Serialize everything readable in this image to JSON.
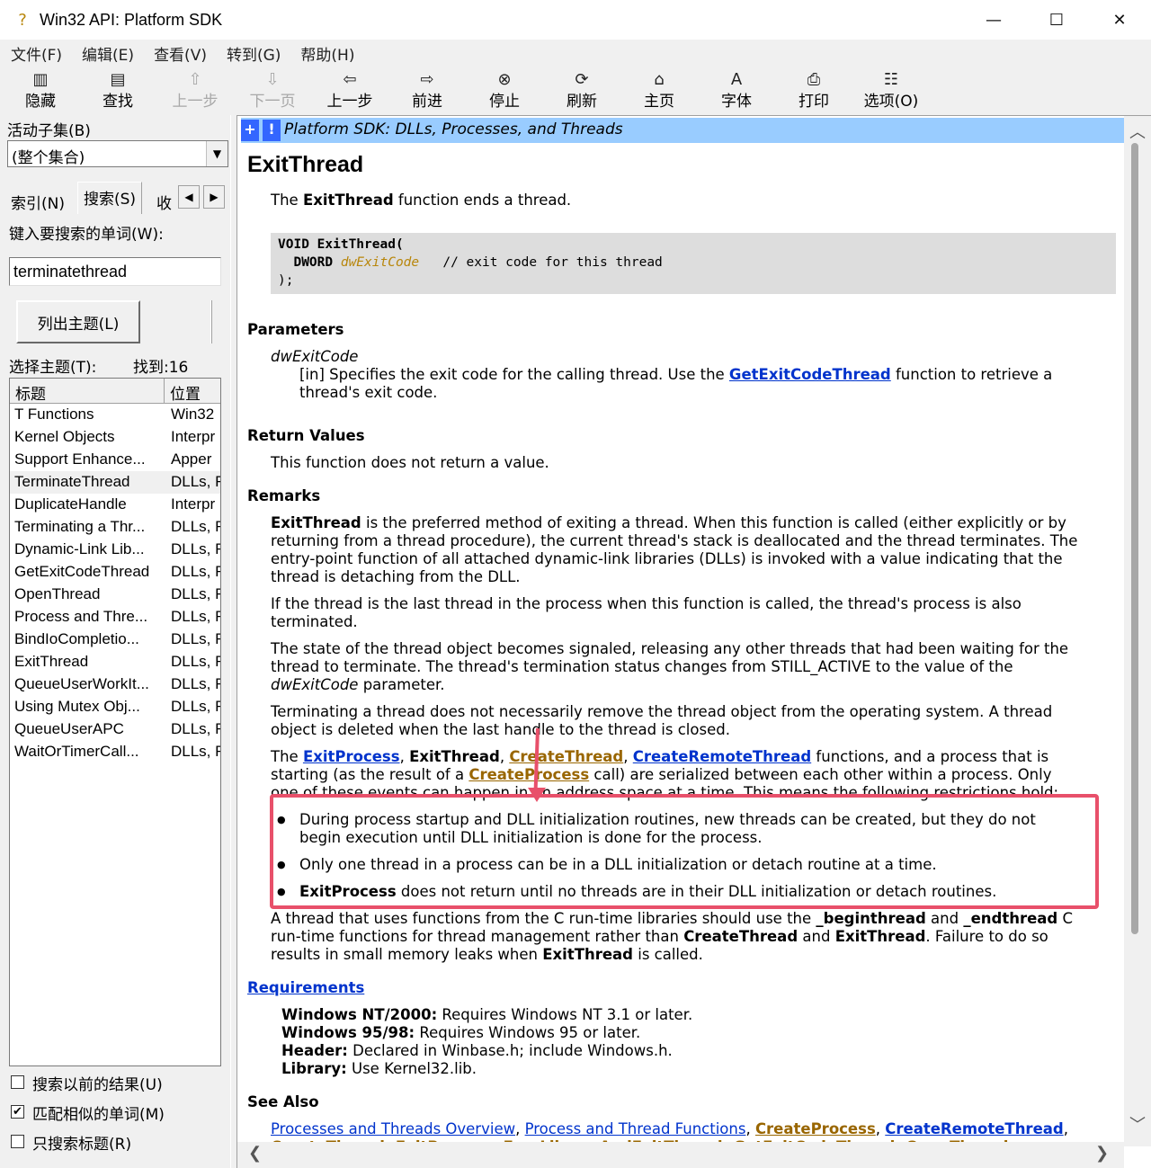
{
  "window": {
    "title": "Win32 API: Platform SDK",
    "minimize": "—",
    "maximize": "☐",
    "close": "✕",
    "app_icon": "?"
  },
  "menu": [
    "文件(F)",
    "编辑(E)",
    "查看(V)",
    "转到(G)",
    "帮助(H)"
  ],
  "toolbar": {
    "hide": "隐藏",
    "find": "查找",
    "up": "上一步",
    "next_page": "下一页",
    "back": "上一步",
    "forward": "前进",
    "stop": "停止",
    "refresh": "刷新",
    "home": "主页",
    "font": "字体",
    "print": "打印",
    "options": "选项(O)"
  },
  "left": {
    "subset_label": "活动子集(B)",
    "subset_value": "(整个集合)",
    "tabs": {
      "index": "索引(N)",
      "search": "搜索(S)",
      "favorites": "收藏"
    },
    "keyword_label": "键入要搜索的单词(W):",
    "keyword_value": "terminatethread",
    "list_button": "列出主题(L)",
    "select_label": "选择主题(T):",
    "found_label": "找到:16",
    "col_title": "标题",
    "col_location": "位置",
    "rows": [
      {
        "title": "T Functions",
        "loc": "Win32"
      },
      {
        "title": "Kernel Objects",
        "loc": "Interpr"
      },
      {
        "title": "Support Enhance...",
        "loc": "Apper"
      },
      {
        "title": "TerminateThread",
        "loc": "DLLs, F"
      },
      {
        "title": "DuplicateHandle",
        "loc": "Interpr"
      },
      {
        "title": "Terminating a Thr...",
        "loc": "DLLs, F"
      },
      {
        "title": "Dynamic-Link Lib...",
        "loc": "DLLs, F"
      },
      {
        "title": "GetExitCodeThread",
        "loc": "DLLs, F"
      },
      {
        "title": "OpenThread",
        "loc": "DLLs, F"
      },
      {
        "title": "Process and Thre...",
        "loc": "DLLs, F"
      },
      {
        "title": "BindIoCompletio...",
        "loc": "DLLs, F"
      },
      {
        "title": "ExitThread",
        "loc": "DLLs, F"
      },
      {
        "title": "QueueUserWorkIt...",
        "loc": "DLLs, F"
      },
      {
        "title": "Using Mutex Obj...",
        "loc": "DLLs, F"
      },
      {
        "title": "QueueUserAPC",
        "loc": "DLLs, F"
      },
      {
        "title": "WaitOrTimerCall...",
        "loc": "DLLs, F"
      }
    ],
    "check_prev": "搜索以前的结果(U)",
    "check_similar": "匹配相似的单词(M)",
    "check_titles": "只搜索标题(R)"
  },
  "doc": {
    "banner_title": "Platform SDK: DLLs, Processes, and Threads",
    "banner_plus": "+",
    "banner_excl": "!",
    "title": "ExitThread",
    "intro_pre": "The ",
    "intro_name": "ExitThread",
    "intro_post": " function ends a thread.",
    "code_l1": "VOID ExitThread(",
    "code_l2_type": "  DWORD ",
    "code_l2_arg": "dwExitCode",
    "code_l2_comment": "   // exit code for this thread",
    "code_l3": ");",
    "h_params": "Parameters",
    "param_name": "dwExitCode",
    "param_desc_1": "[in] Specifies the exit code for the calling thread. Use the ",
    "param_link": "GetExitCodeThread",
    "param_desc_2": " function to retrieve a",
    "param_desc_3": "thread's exit code.",
    "h_return": "Return Values",
    "return_text": "This function does not return a value.",
    "h_remarks": "Remarks",
    "r1_name": "ExitThread",
    "r1_l1": " is the preferred method of exiting a thread. When this function is called (either explicitly or by",
    "r1_l2": "returning from a thread procedure), the current thread's stack is deallocated and the thread terminates. The",
    "r1_l3": "entry-point function of all attached dynamic-link libraries (DLLs) is invoked with a value indicating that the",
    "r1_l4": "thread is detaching from the DLL.",
    "r2_l1": "If the thread is the last thread in the process when this function is called, the thread's process is also",
    "r2_l2": "terminated.",
    "r3_l1": "The state of the thread object becomes signaled, releasing any other threads that had been waiting for the",
    "r3_l2": "thread to terminate. The thread's termination status changes from STILL_ACTIVE to the value of the",
    "r3_l3_i": "dwExitCode",
    "r3_l3": " parameter.",
    "r4_l1": "Terminating a thread does not necessarily remove the thread object from the operating system. A thread",
    "r4_l2": "object is deleted when the last handle to the thread is closed.",
    "r5_the": "The ",
    "r5_link1": "ExitProcess",
    "r5_comma": ", ",
    "r5_b": "ExitThread",
    "r5_link2": "CreateThread",
    "r5_link3": "CreateRemoteThread",
    "r5_l1_end": " functions, and a process that is",
    "r5_l2_pre": "starting (as the result of a ",
    "r5_link4": "CreateProcess",
    "r5_l2_end": " call) are serialized between each other within a process. Only",
    "r5_l3": "one of these events can happen in an address space at a time. This means the following restrictions hold:",
    "bullet": "●",
    "b1_l1": "During process startup and DLL initialization routines, new threads can be created, but they do not",
    "b1_l2": "begin execution until DLL initialization is done for the process.",
    "b2": "Only one thread in a process can be in a DLL initialization or detach routine at a time.",
    "b3_b": "ExitProcess",
    "b3": " does not return until no threads are in their DLL initialization or detach routines.",
    "r6_l1_pre": "A thread that uses functions from the C run-time libraries should use the ",
    "r6_b1": "_beginthread",
    "r6_and": " and ",
    "r6_b2": "_endthread",
    "r6_l1_end": " C",
    "r6_l2_pre": "run-time functions for thread management rather than ",
    "r6_b3": "CreateThread",
    "r6_b4": "ExitThread",
    "r6_l2_end": ". Failure to do so",
    "r6_l3_pre": "results in small memory leaks when ",
    "r6_b5": "ExitThread",
    "r6_l3_end": " is called.",
    "h_requirements": "Requirements",
    "req_nt_b": "Windows NT/2000:",
    "req_nt": " Requires Windows NT 3.1 or later.",
    "req_95_b": "Windows 95/98:",
    "req_95": " Requires Windows 95 or later.",
    "req_hdr_b": "Header:",
    "req_hdr": " Declared in Winbase.h; include Windows.h.",
    "req_lib_b": "Library:",
    "req_lib": " Use Kernel32.lib.",
    "h_seealso": "See Also",
    "sa1": "Processes and Threads Overview",
    "sa2": "Process and Thread Functions",
    "sa3": "CreateProcess",
    "sa4": "CreateRemoteThread",
    "sa_line2": "CreateThread, ExitProcess, FreeLibraryAndExitThread, GetExitCodeThread, OpenThread,"
  },
  "colors": {
    "highlight": "#e8506a",
    "link": "#0033cc",
    "visited_link": "#996600",
    "banner": "#99ccff"
  }
}
